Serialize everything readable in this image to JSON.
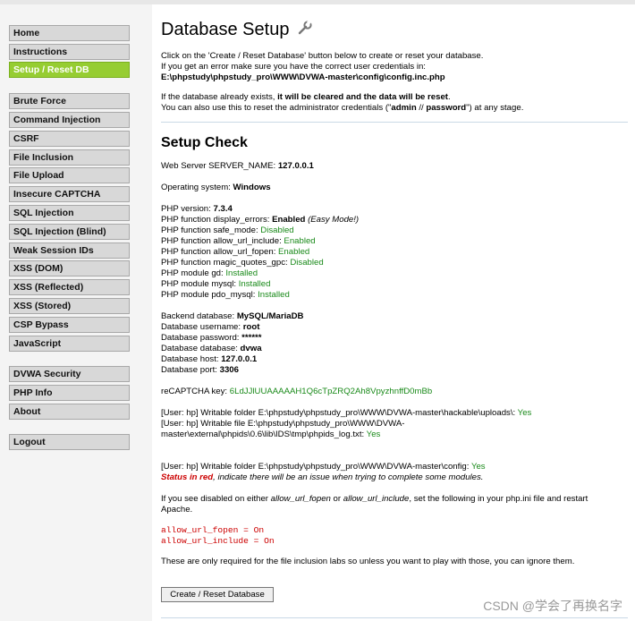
{
  "sidebar": {
    "items": [
      {
        "label": "Home",
        "active": false
      },
      {
        "label": "Instructions",
        "active": false
      },
      {
        "label": "Setup / Reset DB",
        "active": true
      },
      {
        "label": "Brute Force",
        "active": false
      },
      {
        "label": "Command Injection",
        "active": false
      },
      {
        "label": "CSRF",
        "active": false
      },
      {
        "label": "File Inclusion",
        "active": false
      },
      {
        "label": "File Upload",
        "active": false
      },
      {
        "label": "Insecure CAPTCHA",
        "active": false
      },
      {
        "label": "SQL Injection",
        "active": false
      },
      {
        "label": "SQL Injection (Blind)",
        "active": false
      },
      {
        "label": "Weak Session IDs",
        "active": false
      },
      {
        "label": "XSS (DOM)",
        "active": false
      },
      {
        "label": "XSS (Reflected)",
        "active": false
      },
      {
        "label": "XSS (Stored)",
        "active": false
      },
      {
        "label": "CSP Bypass",
        "active": false
      },
      {
        "label": "JavaScript",
        "active": false
      },
      {
        "label": "DVWA Security",
        "active": false
      },
      {
        "label": "PHP Info",
        "active": false
      },
      {
        "label": "About",
        "active": false
      },
      {
        "label": "Logout",
        "active": false
      }
    ]
  },
  "main": {
    "title": "Database Setup",
    "title_icon": "wrench-icon",
    "intro1": "Click on the 'Create / Reset Database' button below to create or reset your database.",
    "intro2": "If you get an error make sure you have the correct user credentials in:",
    "config_path": "E:\\phpstudy\\phpstudy_pro\\WWW\\DVWA-master\\config\\config.inc.php",
    "warn_a": "If the database already exists, ",
    "warn_b": "it will be cleared and the data will be reset",
    "warn_c": ".",
    "reset_a": "You can also use this to reset the administrator credentials (\"",
    "reset_b": "admin",
    "reset_c": " // ",
    "reset_d": "password",
    "reset_e": "\") at any stage.",
    "setup_check": "Setup Check",
    "server_label": "Web Server SERVER_NAME: ",
    "server_value": "127.0.0.1",
    "os_label": "Operating system: ",
    "os_value": "Windows",
    "php_version_label": "PHP version: ",
    "php_version_value": "7.3.4",
    "display_errors_label": "PHP function display_errors: ",
    "display_errors_value": "Enabled",
    "display_errors_note": " (Easy Mode!)",
    "safe_mode_label": "PHP function safe_mode: ",
    "safe_mode_value": "Disabled",
    "allow_url_include_label": "PHP function allow_url_include: ",
    "allow_url_include_value": "Enabled",
    "allow_url_fopen_label": "PHP function allow_url_fopen: ",
    "allow_url_fopen_value": "Enabled",
    "magic_quotes_label": "PHP function magic_quotes_gpc: ",
    "magic_quotes_value": "Disabled",
    "gd_label": "PHP module gd: ",
    "gd_value": "Installed",
    "mysql_label": "PHP module mysql: ",
    "mysql_value": "Installed",
    "pdo_label": "PHP module pdo_mysql: ",
    "pdo_value": "Installed",
    "backend_label": "Backend database: ",
    "backend_value": "MySQL/MariaDB",
    "db_user_label": "Database username: ",
    "db_user_value": "root",
    "db_pass_label": "Database password: ",
    "db_pass_value": "******",
    "db_name_label": "Database database: ",
    "db_name_value": "dvwa",
    "db_host_label": "Database host: ",
    "db_host_value": "127.0.0.1",
    "db_port_label": "Database port: ",
    "db_port_value": "3306",
    "recaptcha_label": "reCAPTCHA key: ",
    "recaptcha_value": "6LdJJlUUAAAAAH1Q6cTpZRQ2Ah8VpyzhnffD0mBb",
    "writable1_label": "[User: hp] Writable folder E:\\phpstudy\\phpstudy_pro\\WWW\\DVWA-master\\hackable\\uploads\\: ",
    "writable1_value": "Yes",
    "writable2_line1": "[User: hp] Writable file E:\\phpstudy\\phpstudy_pro\\WWW\\DVWA-",
    "writable2_line2": "master\\external\\phpids\\0.6\\lib\\IDS\\tmp\\phpids_log.txt: ",
    "writable2_value": "Yes",
    "writable3_label": "[User: hp] Writable folder E:\\phpstudy\\phpstudy_pro\\WWW\\DVWA-master\\config: ",
    "writable3_value": "Yes",
    "status_red": "Status in red",
    "status_rest": ", indicate there will be an issue when trying to complete some modules.",
    "disabled_a": "If you see disabled on either ",
    "disabled_b": "allow_url_fopen",
    "disabled_c": " or ",
    "disabled_d": "allow_url_include",
    "disabled_e": ", set the following in your php.ini file and restart",
    "disabled_line2": "Apache.",
    "code1": "allow_url_fopen = On",
    "code2": "allow_url_include = On",
    "inclusion_note": "These are only required for the file inclusion labs so unless you want to play with those, you can ignore them.",
    "button_label": "Create / Reset Database"
  },
  "watermark": "CSDN @学会了再换名字"
}
